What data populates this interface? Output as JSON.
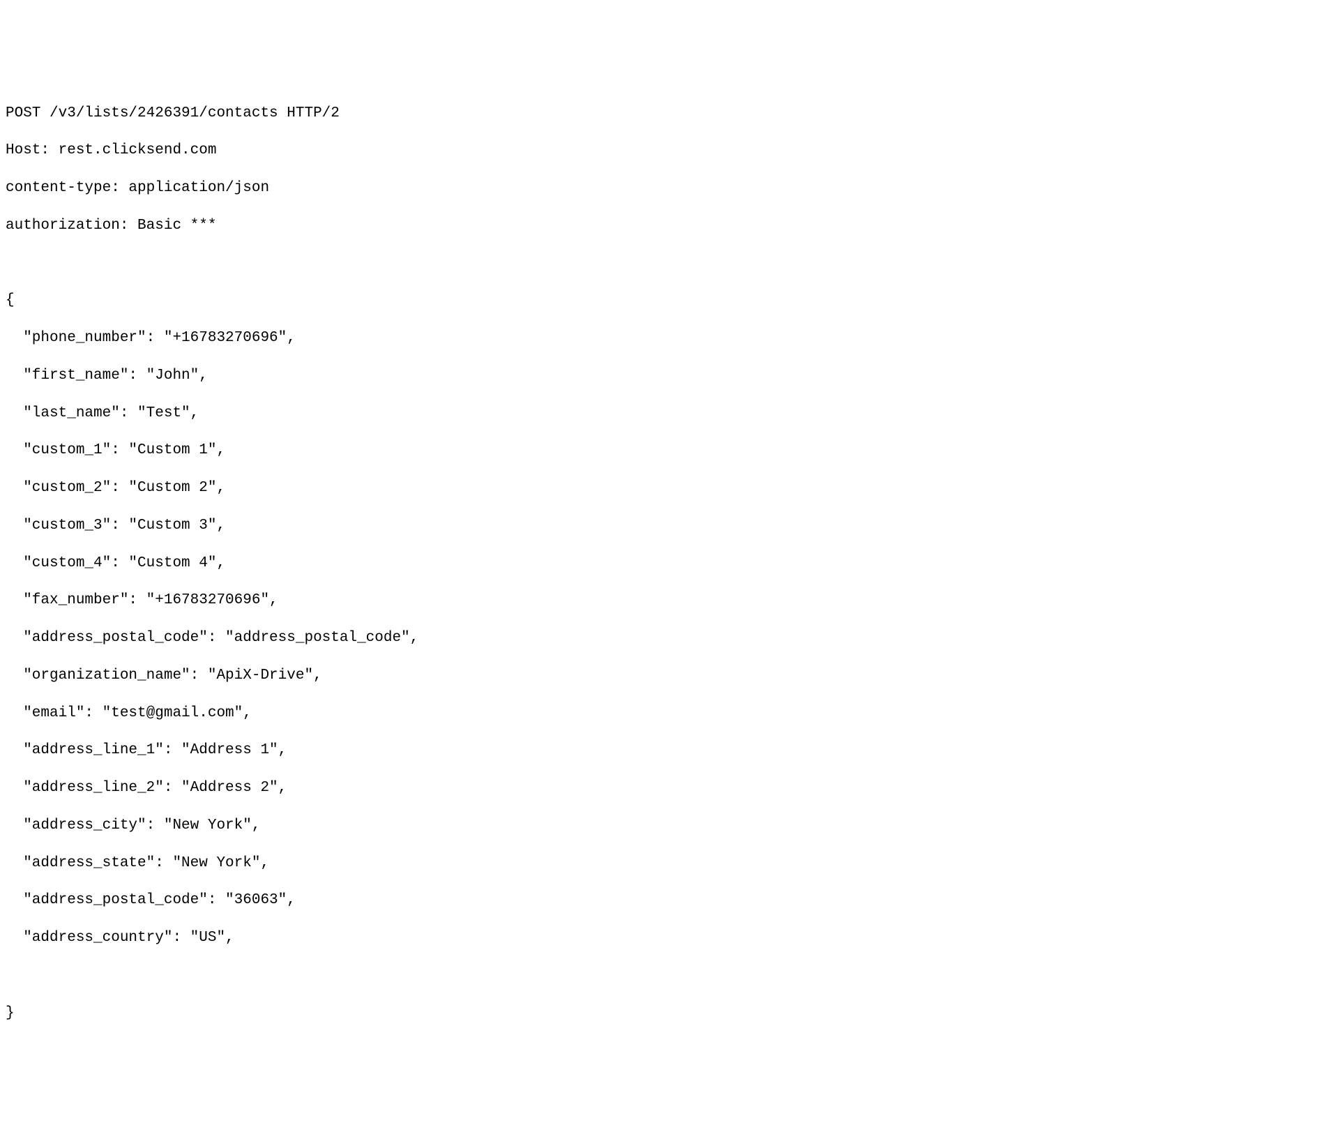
{
  "request": {
    "line1": "POST /v3/lists/2426391/contacts HTTP/2",
    "line2": "Host: rest.clicksend.com",
    "line3": "content-type: application/json",
    "line4": "authorization: Basic ***"
  },
  "body": {
    "open": "{",
    "fields": [
      "\"phone_number\": \"+16783270696\",",
      "\"first_name\": \"John\",",
      "\"last_name\": \"Test\",",
      "\"custom_1\": \"Custom 1\",",
      "\"custom_2\": \"Custom 2\",",
      "\"custom_3\": \"Custom 3\",",
      "\"custom_4\": \"Custom 4\",",
      "\"fax_number\": \"+16783270696\",",
      "\"address_postal_code\": \"address_postal_code\",",
      "\"organization_name\": \"ApiX-Drive\",",
      "\"email\": \"test@gmail.com\",",
      "\"address_line_1\": \"Address 1\",",
      "\"address_line_2\": \"Address 2\",",
      "\"address_city\": \"New York\",",
      "\"address_state\": \"New York\",",
      "\"address_postal_code\": \"36063\",",
      "\"address_country\": \"US\","
    ],
    "close": "}"
  }
}
